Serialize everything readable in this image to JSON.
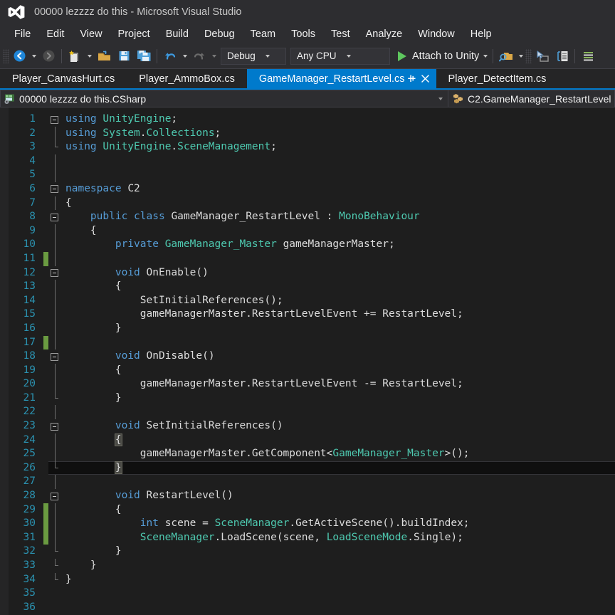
{
  "window": {
    "title": "00000 lezzzz do this - Microsoft Visual Studio",
    "logo_icon": "visual-studio-logo-icon"
  },
  "menu": {
    "items": [
      {
        "label": "File"
      },
      {
        "label": "Edit"
      },
      {
        "label": "View"
      },
      {
        "label": "Project"
      },
      {
        "label": "Build"
      },
      {
        "label": "Debug"
      },
      {
        "label": "Team"
      },
      {
        "label": "Tools"
      },
      {
        "label": "Test"
      },
      {
        "label": "Analyze"
      },
      {
        "label": "Window"
      },
      {
        "label": "Help"
      }
    ]
  },
  "toolbar": {
    "back_icon": "navigate-back-icon",
    "forward_icon": "navigate-forward-icon",
    "new_item_icon": "new-item-icon",
    "open_file_icon": "open-file-icon",
    "save_icon": "save-icon",
    "save_all_icon": "save-all-icon",
    "undo_icon": "undo-icon",
    "redo_icon": "redo-icon",
    "configuration": "Debug",
    "platform": "Any CPU",
    "run_label": "Attach to Unity",
    "run_icon": "play-icon",
    "find_icon": "find-in-files-icon",
    "step_icon": "step-into-icon",
    "compare_icon": "compare-files-icon",
    "list_icon": "task-list-icon"
  },
  "tabs": [
    {
      "label": "Player_CanvasHurt.cs",
      "active": false
    },
    {
      "label": "Player_AmmoBox.cs",
      "active": false
    },
    {
      "label": "GameManager_RestartLevel.cs",
      "active": true,
      "pin_icon": "pin-icon",
      "close_icon": "close-icon"
    },
    {
      "label": "Player_DetectItem.cs",
      "active": false
    }
  ],
  "navbar": {
    "project_icon": "csharp-project-icon",
    "project": "00000 lezzzz do this.CSharp",
    "member_icon": "class-member-icon",
    "member": "C2.GameManager_RestartLevel"
  },
  "editor": {
    "accent_color": "#007acc",
    "background": "#1e1e1e",
    "line_number_color": "#2b91af",
    "change_bar_color": "#6a9b41",
    "lines": [
      {
        "n": 1,
        "text": "using UnityEngine;"
      },
      {
        "n": 2,
        "text": "using System.Collections;"
      },
      {
        "n": 3,
        "text": "using UnityEngine.SceneManagement;"
      },
      {
        "n": 4,
        "text": ""
      },
      {
        "n": 5,
        "text": ""
      },
      {
        "n": 6,
        "text": "namespace C2"
      },
      {
        "n": 7,
        "text": "{"
      },
      {
        "n": 8,
        "text": "    public class GameManager_RestartLevel : MonoBehaviour"
      },
      {
        "n": 9,
        "text": "    {"
      },
      {
        "n": 10,
        "text": "        private GameManager_Master gameManagerMaster;"
      },
      {
        "n": 11,
        "text": "",
        "changed": true
      },
      {
        "n": 12,
        "text": "        void OnEnable()"
      },
      {
        "n": 13,
        "text": "        {"
      },
      {
        "n": 14,
        "text": "            SetInitialReferences();"
      },
      {
        "n": 15,
        "text": "            gameManagerMaster.RestartLevelEvent += RestartLevel;"
      },
      {
        "n": 16,
        "text": "        }"
      },
      {
        "n": 17,
        "text": "",
        "changed": true
      },
      {
        "n": 18,
        "text": "        void OnDisable()"
      },
      {
        "n": 19,
        "text": "        {"
      },
      {
        "n": 20,
        "text": "            gameManagerMaster.RestartLevelEvent -= RestartLevel;"
      },
      {
        "n": 21,
        "text": "        }"
      },
      {
        "n": 22,
        "text": ""
      },
      {
        "n": 23,
        "text": "        void SetInitialReferences()"
      },
      {
        "n": 24,
        "text": "        {",
        "brace_match": true
      },
      {
        "n": 25,
        "text": "            gameManagerMaster.GetComponent<GameManager_Master>();"
      },
      {
        "n": 26,
        "text": "        }",
        "brace_match": true,
        "current": true
      },
      {
        "n": 27,
        "text": ""
      },
      {
        "n": 28,
        "text": "        void RestartLevel()"
      },
      {
        "n": 29,
        "text": "        {",
        "changed": true
      },
      {
        "n": 30,
        "text": "            int scene = SceneManager.GetActiveScene().buildIndex;",
        "changed": true
      },
      {
        "n": 31,
        "text": "            SceneManager.LoadScene(scene, LoadSceneMode.Single);",
        "changed": true
      },
      {
        "n": 32,
        "text": "        }"
      },
      {
        "n": 33,
        "text": "    }"
      },
      {
        "n": 34,
        "text": "}"
      },
      {
        "n": 35,
        "text": ""
      },
      {
        "n": 36,
        "text": ""
      }
    ]
  }
}
